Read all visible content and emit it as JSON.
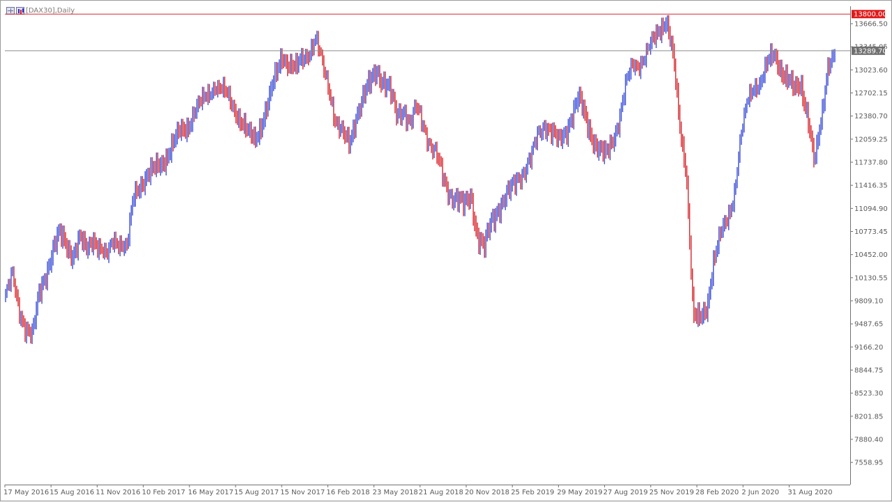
{
  "window": {
    "title": "[DAX30],Daily"
  },
  "icons": [
    "chart-window-icon",
    "bar-chart-icon"
  ],
  "colors": {
    "bull": "#3b4ed8",
    "bear": "#d8242a",
    "resistance": "#d8242a",
    "current": "#8a8a8a",
    "tag_current": "#707070",
    "tag_resistance": "#e01b1b"
  },
  "chart_data": {
    "type": "bar",
    "title": "[DAX30],Daily",
    "xlabel": "",
    "ylabel": "",
    "ylim": [
      7400,
      13900
    ],
    "grid": false,
    "y_ticks": [
      "13666.50",
      "13345.05",
      "13023.60",
      "12702.15",
      "12380.70",
      "12059.25",
      "11737.80",
      "11416.35",
      "11094.90",
      "10773.45",
      "10452.00",
      "10130.55",
      "9809.10",
      "9487.65",
      "9166.20",
      "8844.75",
      "8523.30",
      "8201.85",
      "7880.40",
      "7558.95"
    ],
    "y_tick_values": [
      13666.5,
      13345.05,
      13023.6,
      12702.15,
      12380.7,
      12059.25,
      11737.8,
      11416.35,
      11094.9,
      10773.45,
      10452.0,
      10130.55,
      9809.1,
      9487.65,
      9166.2,
      8844.75,
      8523.3,
      8201.85,
      7880.4,
      7558.95
    ],
    "x_ticks": [
      "17 May 2016",
      "15 Aug 2016",
      "11 Nov 2016",
      "10 Feb 2017",
      "16 May 2017",
      "15 Aug 2017",
      "15 Nov 2017",
      "16 Feb 2018",
      "23 May 2018",
      "21 Aug 2018",
      "20 Nov 2018",
      "25 Feb 2019",
      "29 May 2019",
      "27 Aug 2019",
      "25 Nov 2019",
      "28 Feb 2020",
      "2 Jun 2020",
      "31 Aug 2020"
    ],
    "price_levels": [
      {
        "label": "13800.00",
        "value": 13800.0,
        "role": "resistance"
      },
      {
        "label": "13289.70",
        "value": 13289.7,
        "role": "current"
      }
    ],
    "series": [
      {
        "values": [
          9900,
          10150,
          9700,
          9450,
          9300,
          9900,
          10200,
          10500,
          10700,
          10600,
          10450,
          10650,
          10500,
          10720,
          10550,
          10400,
          10700,
          10650,
          10520,
          11250,
          11450,
          11550,
          11600,
          11700,
          11850,
          12000,
          12150,
          12250,
          12450,
          12550,
          12700,
          12850,
          12750,
          12650,
          12500,
          12300,
          12100,
          12050,
          12300,
          12550,
          12900,
          13250,
          13100,
          13000,
          13200,
          13300,
          13450,
          13100,
          12800,
          12300,
          12100,
          12000,
          12400,
          12600,
          12800,
          13050,
          12850,
          12700,
          12400,
          12500,
          12250,
          12500,
          12300,
          12000,
          11800,
          11500,
          11300,
          11200,
          11100,
          11300,
          10700,
          10500,
          10900,
          11100,
          11200,
          11350,
          11550,
          11650,
          11800,
          12150,
          12300,
          12150,
          12000,
          12150,
          12400,
          12600,
          12350,
          12100,
          11900,
          11800,
          12050,
          12350,
          12800,
          13100,
          13150,
          13250,
          13400,
          13600,
          13750,
          13200,
          12200,
          11600,
          9600,
          9500,
          9700,
          10400,
          10700,
          10900,
          11300,
          12100,
          12550,
          12800,
          12900,
          13100,
          13200,
          13050,
          12900,
          12700,
          12800,
          12400,
          11700,
          12300,
          13150,
          13289.7
        ]
      }
    ]
  }
}
